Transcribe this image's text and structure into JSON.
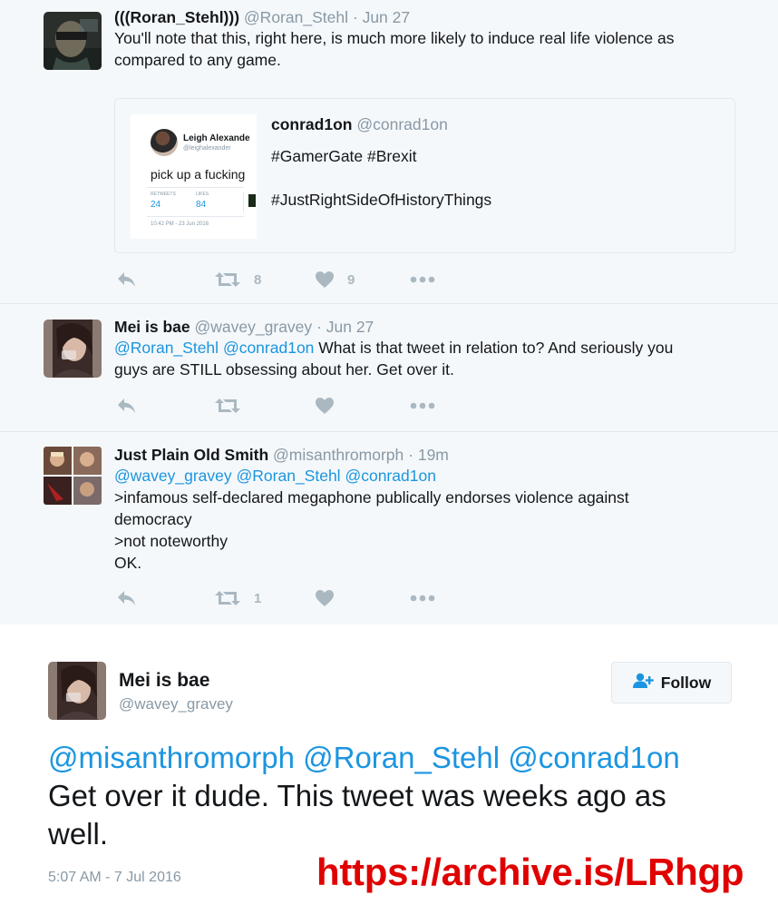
{
  "tweets": [
    {
      "name": "(((Roran_Stehl)))",
      "handle": "@Roran_Stehl",
      "sep": "·",
      "time": "Jun 27",
      "lines": [
        [
          {
            "t": "You'll note that this, right here, is much more likely to induce real life violence as"
          }
        ],
        [
          {
            "t": "compared to any game."
          }
        ]
      ],
      "quote": {
        "name": "conrad1on",
        "handle": "@conrad1on",
        "line1": "#GamerGate #Brexit",
        "line2": "#JustRightSideOfHistoryThings",
        "media": {
          "name": "Leigh Alexande",
          "handle": "@leighalexander",
          "text": "pick up a fucking",
          "retweets_label": "RETWEETS",
          "likes_label": "LIKES",
          "retweets": "24",
          "likes": "84",
          "date": "10:42 PM - 23 Jun 2016"
        }
      },
      "retweets": "8",
      "likes": "9"
    },
    {
      "name": "Mei is bae",
      "handle": "@wavey_gravey",
      "sep": "·",
      "time": "Jun 27",
      "lines": [
        [
          {
            "m": "@Roran_Stehl"
          },
          {
            "t": " "
          },
          {
            "m": "@conrad1on"
          },
          {
            "t": " What is that tweet in relation to? And seriously you"
          }
        ],
        [
          {
            "t": "guys are STILL obsessing about her. Get over it."
          }
        ]
      ],
      "retweets": "",
      "likes": ""
    },
    {
      "name": "Just Plain Old Smith",
      "handle": "@misanthromorph",
      "sep": "·",
      "time": "19m",
      "lines": [
        [
          {
            "m": "@wavey_gravey"
          },
          {
            "t": " "
          },
          {
            "m": "@Roran_Stehl"
          },
          {
            "t": " "
          },
          {
            "m": "@conrad1on"
          }
        ],
        [
          {
            "t": ">infamous self-declared megaphone publically endorses violence against"
          }
        ],
        [
          {
            "t": "democracy"
          }
        ],
        [
          {
            "t": ">not noteworthy"
          }
        ],
        [
          {
            "t": "OK."
          }
        ]
      ],
      "retweets": "1",
      "likes": ""
    }
  ],
  "main": {
    "name": "Mei is bae",
    "handle": "@wavey_gravey",
    "follow_label": "Follow",
    "lines": [
      [
        {
          "m": "@misanthromorph"
        },
        {
          "t": " "
        },
        {
          "m": "@Roran_Stehl"
        },
        {
          "t": " "
        },
        {
          "m": "@conrad1on"
        }
      ],
      [
        {
          "t": "Get over it dude. This tweet was weeks ago as"
        }
      ],
      [
        {
          "t": "well."
        }
      ]
    ],
    "timestamp": "5:07 AM - 7 Jul 2016"
  },
  "watermark": "https://archive.is/LRhgp",
  "icons": {
    "reply": "reply-icon",
    "retweet": "retweet-icon",
    "like": "heart-icon",
    "more": "more-icon",
    "follow": "add-user-icon"
  },
  "colors": {
    "link": "#1b95e0",
    "muted": "#8899a6",
    "icon": "#aab8c2",
    "watermark": "#e00000"
  }
}
